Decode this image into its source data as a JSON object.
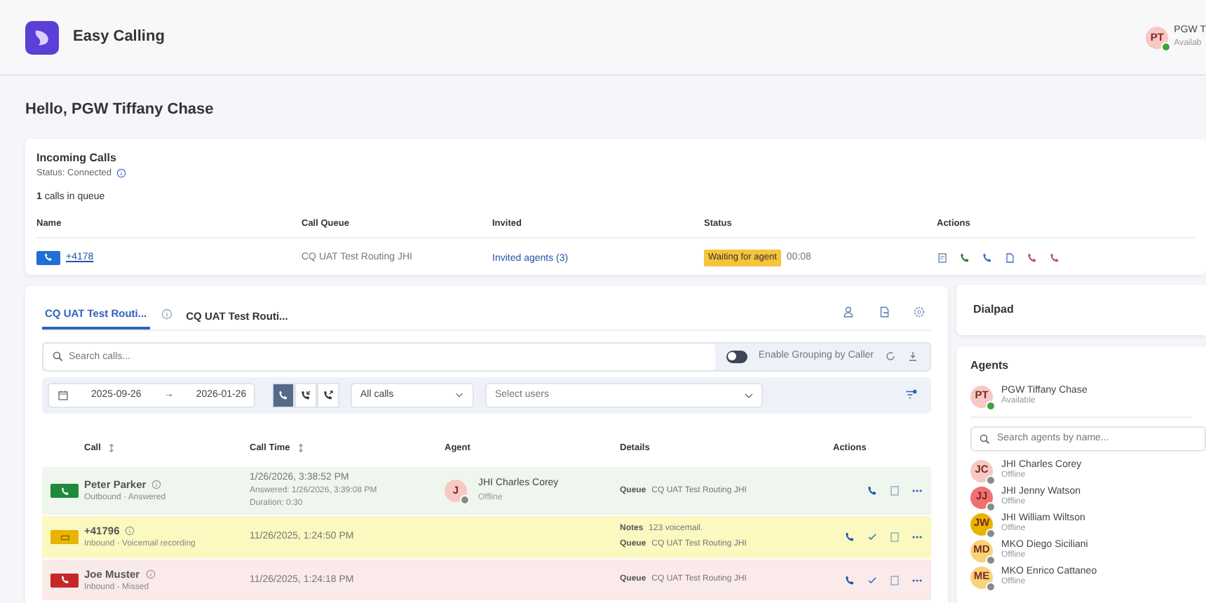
{
  "header": {
    "app_title": "Easy Calling",
    "user": {
      "initials": "PT",
      "name": "PGW T",
      "status": "Availab",
      "online": true
    }
  },
  "greeting": "Hello, PGW Tiffany Chase",
  "incoming": {
    "title": "Incoming Calls",
    "status_text": "Status: Connected",
    "queue_text": "**1** calls in queue",
    "columns": [
      "Name",
      "Call Queue",
      "Invited",
      "Status",
      "Actions"
    ],
    "rows": [
      {
        "number": "+4178",
        "queue": "CQ UAT Test Routing JHI",
        "invited": "Invited agents (3)",
        "status": "Waiting for agent",
        "timer": "00:08"
      }
    ]
  },
  "calls": {
    "tabs": [
      {
        "label": "CQ UAT Test Routi...",
        "selected": true
      },
      {
        "label": "CQ UAT Test Routi...",
        "selected": false
      }
    ],
    "search": {
      "placeholder": "Search calls..."
    },
    "grouping": {
      "label": "Enable Grouping by Caller",
      "on": false
    },
    "date_from": "2025-09-26",
    "date_to": "2026-01-26",
    "arrow": "→",
    "direction_buttons": [
      {
        "kind": "all",
        "selected": true
      },
      {
        "kind": "inbound",
        "selected": false
      },
      {
        "kind": "outbound",
        "selected": false
      }
    ],
    "call_type": "All calls",
    "users": {
      "placeholder": "Select users"
    },
    "columns": [
      {
        "label": "Call",
        "sortable": true
      },
      {
        "label": "Call Time",
        "sortable": true
      },
      {
        "label": "Agent",
        "sortable": false
      },
      {
        "label": "Details",
        "sortable": false
      },
      {
        "label": "Actions",
        "sortable": false
      }
    ],
    "rows": [
      {
        "kind": "answered",
        "name": "Peter Parker",
        "subtitle": "Outbound · Answered",
        "time": "1/26/2026, 3:38:52 PM",
        "extra": [
          "Answered: 1/26/2026, 3:39:08 PM",
          "Duration: 0:30"
        ],
        "agent": {
          "initials": "J",
          "name": "JHI Charles Corey",
          "status": "Offline"
        },
        "details": [
          {
            "label": "Queue",
            "value": "CQ UAT Test Routing JHI"
          }
        ],
        "can_check": false
      },
      {
        "kind": "voicemail",
        "name": "+41796",
        "subtitle": "Inbound · Voicemail recording",
        "time": "11/26/2025, 1:24:50 PM",
        "extra": [],
        "details": [
          {
            "label": "Notes",
            "value": "123 voicemail."
          },
          {
            "label": "Queue",
            "value": "CQ UAT Test Routing JHI"
          }
        ],
        "can_check": true
      },
      {
        "kind": "missed",
        "name": "Joe Muster",
        "subtitle": "Inbound · Missed",
        "time": "11/26/2025, 1:24:18 PM",
        "extra": [],
        "details": [
          {
            "label": "Queue",
            "value": "CQ UAT Test Routing JHI"
          }
        ],
        "can_check": true
      }
    ]
  },
  "dialpad": {
    "title": "Dialpad"
  },
  "agents": {
    "title": "Agents",
    "me": {
      "initials": "PT",
      "name": "PGW Tiffany Chase",
      "status": "Available",
      "online": true,
      "color": "#f8c8c4"
    },
    "search": {
      "placeholder": "Search agents by name..."
    },
    "list": [
      {
        "initials": "JC",
        "name": "JHI Charles Corey",
        "status": "Offline",
        "online": false,
        "color": "#f8c8c4"
      },
      {
        "initials": "JJ",
        "name": "JHI Jenny Watson",
        "status": "Offline",
        "online": false,
        "color": "#f07070"
      },
      {
        "initials": "JW",
        "name": "JHI William Wiltson",
        "status": "Offline",
        "online": false,
        "color": "#e8b400"
      },
      {
        "initials": "MD",
        "name": "MKO Diego Siciliani",
        "status": "Offline",
        "online": false,
        "color": "#f7d37a"
      },
      {
        "initials": "ME",
        "name": "MKO Enrico Cattaneo",
        "status": "Offline",
        "online": false,
        "color": "#f7d37a"
      }
    ]
  }
}
